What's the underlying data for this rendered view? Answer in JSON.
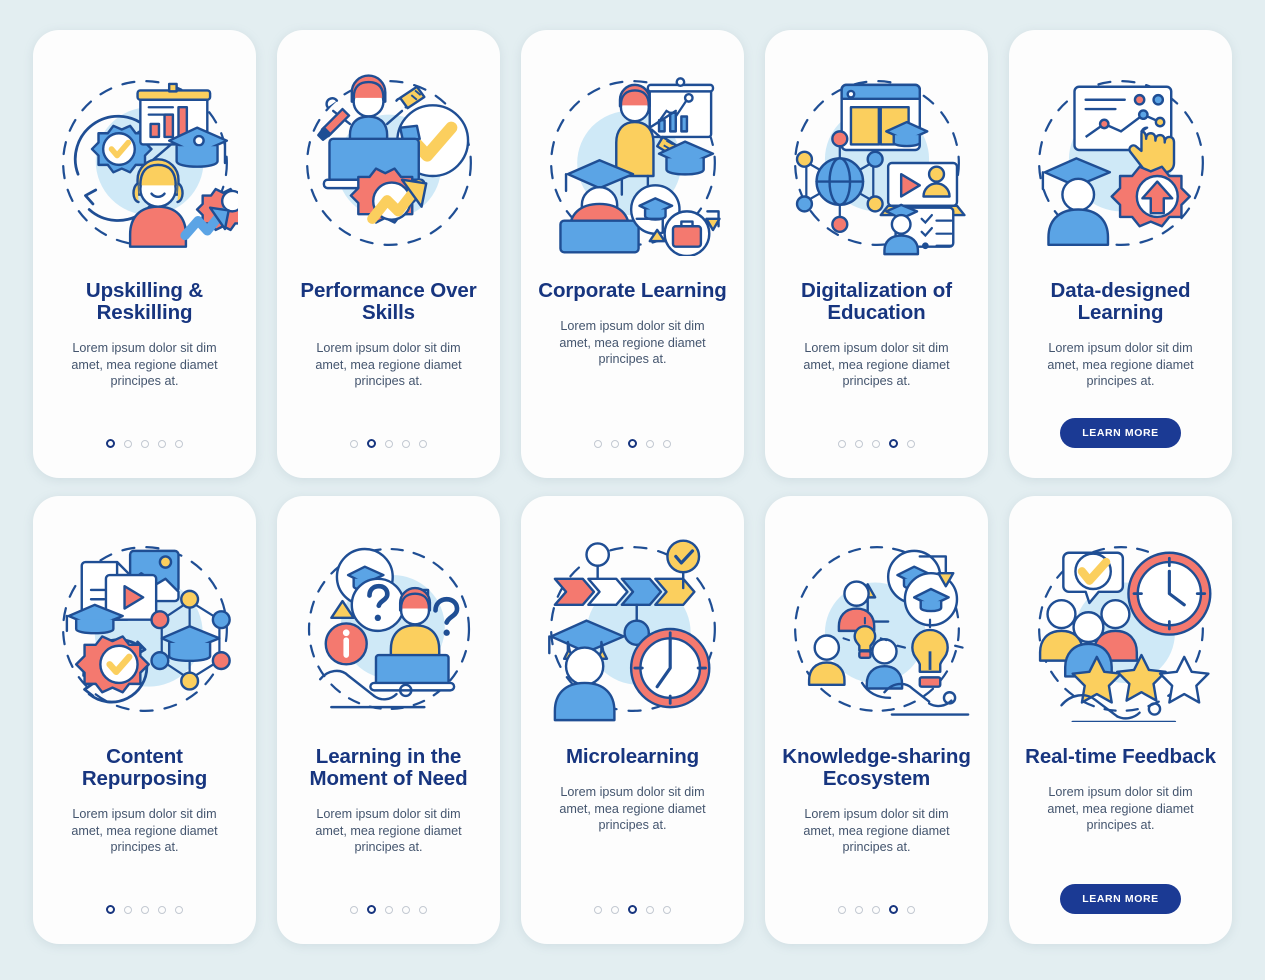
{
  "theme": {
    "page_background": "#e3eef1",
    "card_background": "#fdfdfd",
    "title_color": "#17357f",
    "body_color": "#44556e",
    "accent_blue": "#5ba4e5",
    "accent_coral": "#f4796f",
    "accent_yellow": "#fbcf5e",
    "outline_navy": "#1f4e94",
    "blob_blue": "#cfe9f7",
    "dot_active": "#17357f",
    "dot_inactive": "#c3c9d2",
    "button_background": "#1b3a94",
    "button_text": "#ffffff"
  },
  "shared": {
    "body_text": "Lorem ipsum dolor sit dim amet, mea regione diamet principes at.",
    "learn_more_label": "LEARN MORE",
    "total_dots": 5
  },
  "cards": [
    {
      "title": "Upskilling & Reskilling",
      "body": "Lorem ipsum dolor sit dim amet, mea regione diamet principes at.",
      "illustration": "gear-check-presentation-graduate-woman-icon",
      "footer_type": "dots",
      "active_dot": 0
    },
    {
      "title": "Performance Over Skills",
      "body": "Lorem ipsum dolor sit dim amet, mea regione diamet principes at.",
      "illustration": "multitasking-person-checkmark-gear-growth-icon",
      "footer_type": "dots",
      "active_dot": 1
    },
    {
      "title": "Corporate Learning",
      "body": "Lorem ipsum dolor sit dim amet, mea regione diamet principes at.",
      "illustration": "trainer-whiteboard-graduate-briefcase-icon",
      "footer_type": "dots",
      "active_dot": 2
    },
    {
      "title": "Digitalization of Education",
      "body": "Lorem ipsum dolor sit dim amet, mea regione diamet principes at.",
      "illustration": "browser-book-globe-network-video-checklist-icon",
      "footer_type": "dots",
      "active_dot": 3
    },
    {
      "title": "Data-designed Learning",
      "body": "Lorem ipsum dolor sit dim amet, mea regione diamet principes at.",
      "illustration": "data-chart-cursor-graduate-gear-arrow-icon",
      "footer_type": "button",
      "button_label": "LEARN MORE"
    },
    {
      "title": "Content Repurposing",
      "body": "Lorem ipsum dolor sit dim amet, mea regione diamet principes at.",
      "illustration": "documents-video-graduate-network-gear-check-icon",
      "footer_type": "dots",
      "active_dot": 0
    },
    {
      "title": "Learning in the Moment of Need",
      "body": "Lorem ipsum dolor sit dim amet, mea regione diamet principes at.",
      "illustration": "question-mark-info-laptop-learner-hand-icon",
      "footer_type": "dots",
      "active_dot": 1
    },
    {
      "title": "Microlearning",
      "body": "Lorem ipsum dolor sit dim amet, mea regione diamet principes at.",
      "illustration": "arrow-steps-graduate-clock-icon",
      "footer_type": "dots",
      "active_dot": 2
    },
    {
      "title": "Knowledge-sharing Ecosystem",
      "body": "Lorem ipsum dolor sit dim amet, mea regione diamet principes at.",
      "illustration": "people-lightbulbs-graduation-caps-hand-icon",
      "footer_type": "dots",
      "active_dot": 3
    },
    {
      "title": "Real-time Feedback",
      "body": "Lorem ipsum dolor sit dim amet, mea regione diamet principes at.",
      "illustration": "people-clock-stars-hand-check-icon",
      "footer_type": "button",
      "button_label": "LEARN MORE"
    }
  ]
}
